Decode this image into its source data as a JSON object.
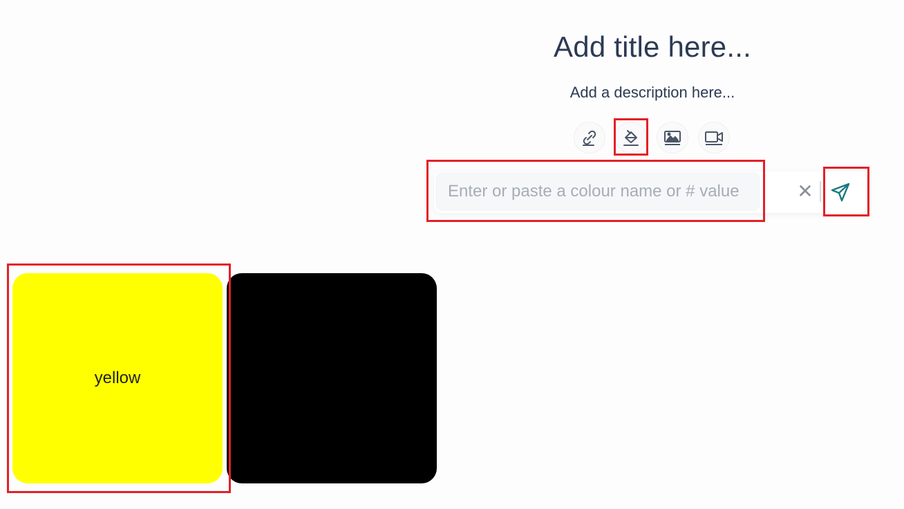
{
  "header": {
    "title": "Add title here...",
    "description": "Add a description here..."
  },
  "toolbar": {
    "items": [
      {
        "icon": "link-icon",
        "active": false
      },
      {
        "icon": "paint-bucket-icon",
        "active": true
      },
      {
        "icon": "image-icon",
        "active": false
      },
      {
        "icon": "video-camera-icon",
        "active": false
      }
    ]
  },
  "colour_input": {
    "placeholder": "Enter or paste a colour name or # value",
    "value": "",
    "clear_icon": "close-icon",
    "clear_label": "✕",
    "submit_icon": "send-icon"
  },
  "swatches": [
    {
      "label": "yellow",
      "color": "#ffff00",
      "text_color": "#222222"
    },
    {
      "label": "",
      "color": "#000000",
      "text_color": "#ffffff"
    }
  ],
  "colors": {
    "text": "#2d3a55",
    "icon": "#4a5568",
    "send": "#1a7a80",
    "annotation": "#e32028"
  }
}
